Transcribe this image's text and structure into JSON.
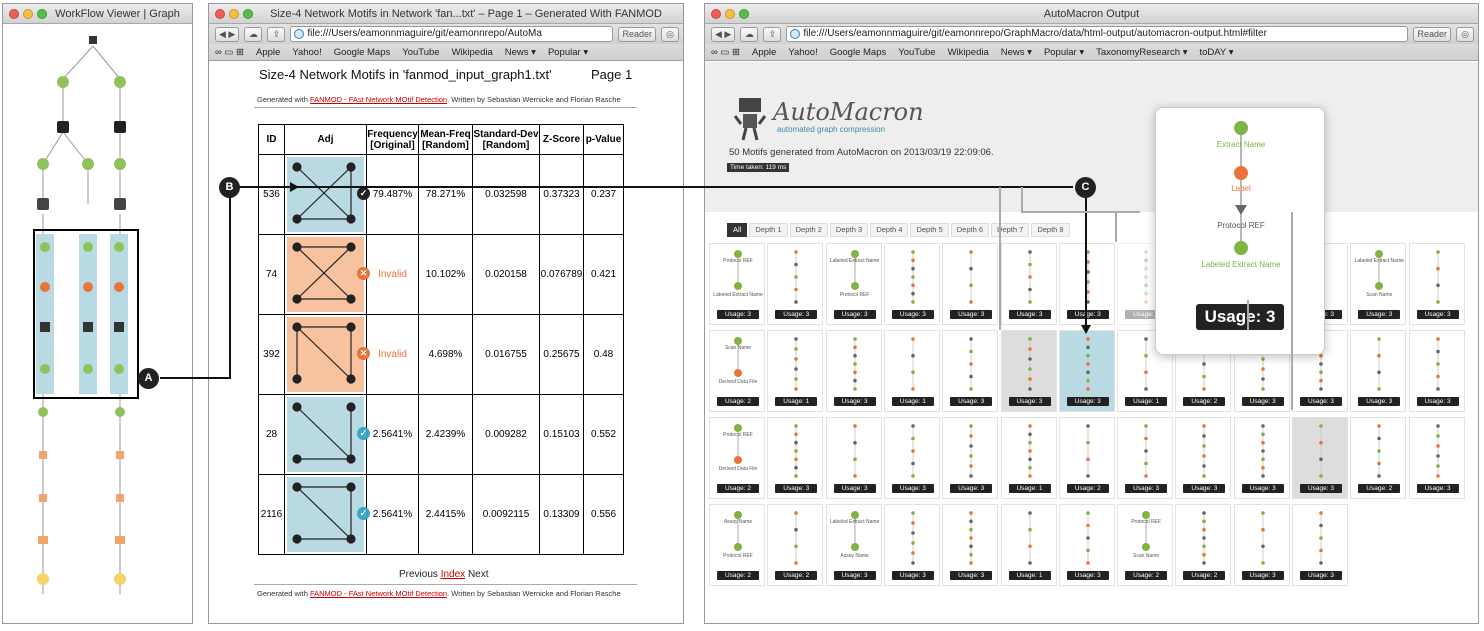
{
  "window1": {
    "title": "WorkFlow Viewer | Graph"
  },
  "window2": {
    "title": "Size-4 Network Motifs in Network 'fan...txt' – Page 1 – Generated With FANMOD",
    "url": "file:///Users/eamonnmaguire/git/eamonnrepo/AutoMa",
    "reader": "Reader",
    "bookmarks": [
      "Apple",
      "Yahoo!",
      "Google Maps",
      "YouTube",
      "Wikipedia",
      "News ▾",
      "Popular ▾"
    ],
    "page_title": "Size-4 Network Motifs in 'fanmod_input_graph1.txt'",
    "page_num": "Page 1",
    "gen_prefix": "Generated with",
    "gen_link": "FANMOD - FAst Network MOtif Detection",
    "gen_suffix": ". Written by Sebastian Wernicke and Florian Rasche",
    "headers": [
      "ID",
      "Adj",
      "Frequency [Original]",
      "Mean-Freq [Random]",
      "Standard-Dev [Random]",
      "Z-Score",
      "p-Value"
    ],
    "rows": [
      {
        "id": "536",
        "freq": "79.487%",
        "mean": "78.271%",
        "sd": "0.032598",
        "z": "0.37323",
        "p": "0.237",
        "status": "valid"
      },
      {
        "id": "74",
        "freq": "Invalid",
        "mean": "10.102%",
        "sd": "0.020158",
        "z": "0.076789",
        "p": "0.421",
        "status": "invalid"
      },
      {
        "id": "392",
        "freq": "Invalid",
        "mean": "4.698%",
        "sd": "0.016755",
        "z": "0.25675",
        "p": "0.48",
        "status": "invalid"
      },
      {
        "id": "28",
        "freq": "2.5641%",
        "mean": "2.4239%",
        "sd": "0.009282",
        "z": "0.15103",
        "p": "0.552",
        "status": "valid"
      },
      {
        "id": "2116",
        "freq": "2.5641%",
        "mean": "2.4415%",
        "sd": "0.0092115",
        "z": "0.13309",
        "p": "0.556",
        "status": "valid"
      }
    ],
    "nav_prev": "Previous",
    "nav_index": "Index",
    "nav_next": "Next"
  },
  "window3": {
    "title": "AutoMacron Output",
    "url": "file:///Users/eamonnmaguire/git/eamonnrepo/GraphMacro/data/html-output/automacron-output.html#filter",
    "reader": "Reader",
    "bookmarks": [
      "Apple",
      "Yahoo!",
      "Google Maps",
      "YouTube",
      "Wikipedia",
      "News ▾",
      "Popular ▾",
      "TaxonomyResearch ▾",
      "toDAY ▾"
    ],
    "logo": "AutoMacron",
    "logo_sub": "automated graph compression",
    "summary": "50 Motifs generated from AutoMacron on 2013/03/19 22:09:06.",
    "time_taken": "Time taken: 119 ms",
    "depth_tabs": [
      "All",
      "Depth 1",
      "Depth 2",
      "Depth 3",
      "Depth 4",
      "Depth 5",
      "Depth 6",
      "Depth 7",
      "Depth 8"
    ],
    "popup": {
      "node1": "Extract Name",
      "node2": "Label",
      "node3": "Protocol REF",
      "node4": "Labeled Extract Name",
      "usage": "Usage: 3"
    },
    "cards": [
      {
        "usage": "Usage: 3",
        "l1": "Protocol REF",
        "l2": "Labeled Extract Name",
        "style": "normal"
      },
      {
        "usage": "Usage: 3",
        "style": "normal"
      },
      {
        "usage": "Usage: 3",
        "l1": "Labeled Extract Name",
        "l2": "Protocol REF",
        "style": "normal"
      },
      {
        "usage": "Usage: 3",
        "style": "normal"
      },
      {
        "usage": "Usage: 3",
        "style": "normal"
      },
      {
        "usage": "Usage: 3",
        "style": "normal"
      },
      {
        "usage": "Usage: 3",
        "style": "normal"
      },
      {
        "usage": "Usage: 3",
        "style": "faded"
      },
      {
        "usage": "Usage: 3",
        "style": "normal"
      },
      {
        "usage": "Usage: 3",
        "style": "normal"
      },
      {
        "usage": "Usage: 3",
        "style": "normal"
      },
      {
        "usage": "Usage: 3",
        "l1": "Labeled Extract Name",
        "l2": "Scan Name",
        "style": "normal"
      },
      {
        "usage": "Usage: 3",
        "style": "normal"
      },
      {
        "usage": "Usage: 2",
        "l1": "Scan Name",
        "l2": "Derived Data File",
        "style": "normal"
      },
      {
        "usage": "Usage: 1",
        "style": "normal"
      },
      {
        "usage": "Usage: 3",
        "style": "normal"
      },
      {
        "usage": "Usage: 1",
        "style": "normal"
      },
      {
        "usage": "Usage: 3",
        "style": "normal"
      },
      {
        "usage": "Usage: 3",
        "style": "gray"
      },
      {
        "usage": "Usage: 3",
        "style": "teal"
      },
      {
        "usage": "Usage: 1",
        "style": "normal"
      },
      {
        "usage": "Usage: 2",
        "style": "normal"
      },
      {
        "usage": "Usage: 3",
        "style": "normal"
      },
      {
        "usage": "Usage: 3",
        "style": "normal"
      },
      {
        "usage": "Usage: 3",
        "style": "normal"
      },
      {
        "usage": "Usage: 3",
        "style": "normal"
      },
      {
        "usage": "Usage: 2",
        "l1": "Protocol REF",
        "l2": "Derived Data File",
        "style": "normal"
      },
      {
        "usage": "Usage: 3",
        "style": "normal"
      },
      {
        "usage": "Usage: 3",
        "style": "normal"
      },
      {
        "usage": "Usage: 3",
        "style": "normal"
      },
      {
        "usage": "Usage: 3",
        "style": "normal"
      },
      {
        "usage": "Usage: 1",
        "style": "normal"
      },
      {
        "usage": "Usage: 2",
        "style": "normal"
      },
      {
        "usage": "Usage: 3",
        "style": "normal"
      },
      {
        "usage": "Usage: 3",
        "style": "normal"
      },
      {
        "usage": "Usage: 3",
        "style": "normal"
      },
      {
        "usage": "Usage: 3",
        "style": "gray"
      },
      {
        "usage": "Usage: 2",
        "style": "normal"
      },
      {
        "usage": "Usage: 3",
        "style": "normal"
      },
      {
        "usage": "Usage: 2",
        "l1": "Assay Name",
        "l2": "Protocol REF",
        "style": "normal"
      },
      {
        "usage": "Usage: 2",
        "style": "normal"
      },
      {
        "usage": "Usage: 3",
        "l1": "Labeled Extract Name",
        "l2": "Assay Name",
        "style": "normal"
      },
      {
        "usage": "Usage: 3",
        "style": "normal"
      },
      {
        "usage": "Usage: 3",
        "style": "normal"
      },
      {
        "usage": "Usage: 1",
        "style": "normal"
      },
      {
        "usage": "Usage: 3",
        "style": "normal"
      },
      {
        "usage": "Usage: 2",
        "l1": "Protocol REF",
        "l2": "Scan Name",
        "style": "normal"
      },
      {
        "usage": "Usage: 2",
        "style": "normal"
      },
      {
        "usage": "Usage: 3",
        "style": "normal"
      },
      {
        "usage": "Usage: 3",
        "style": "normal"
      }
    ]
  },
  "callouts": [
    "A",
    "B",
    "C"
  ]
}
